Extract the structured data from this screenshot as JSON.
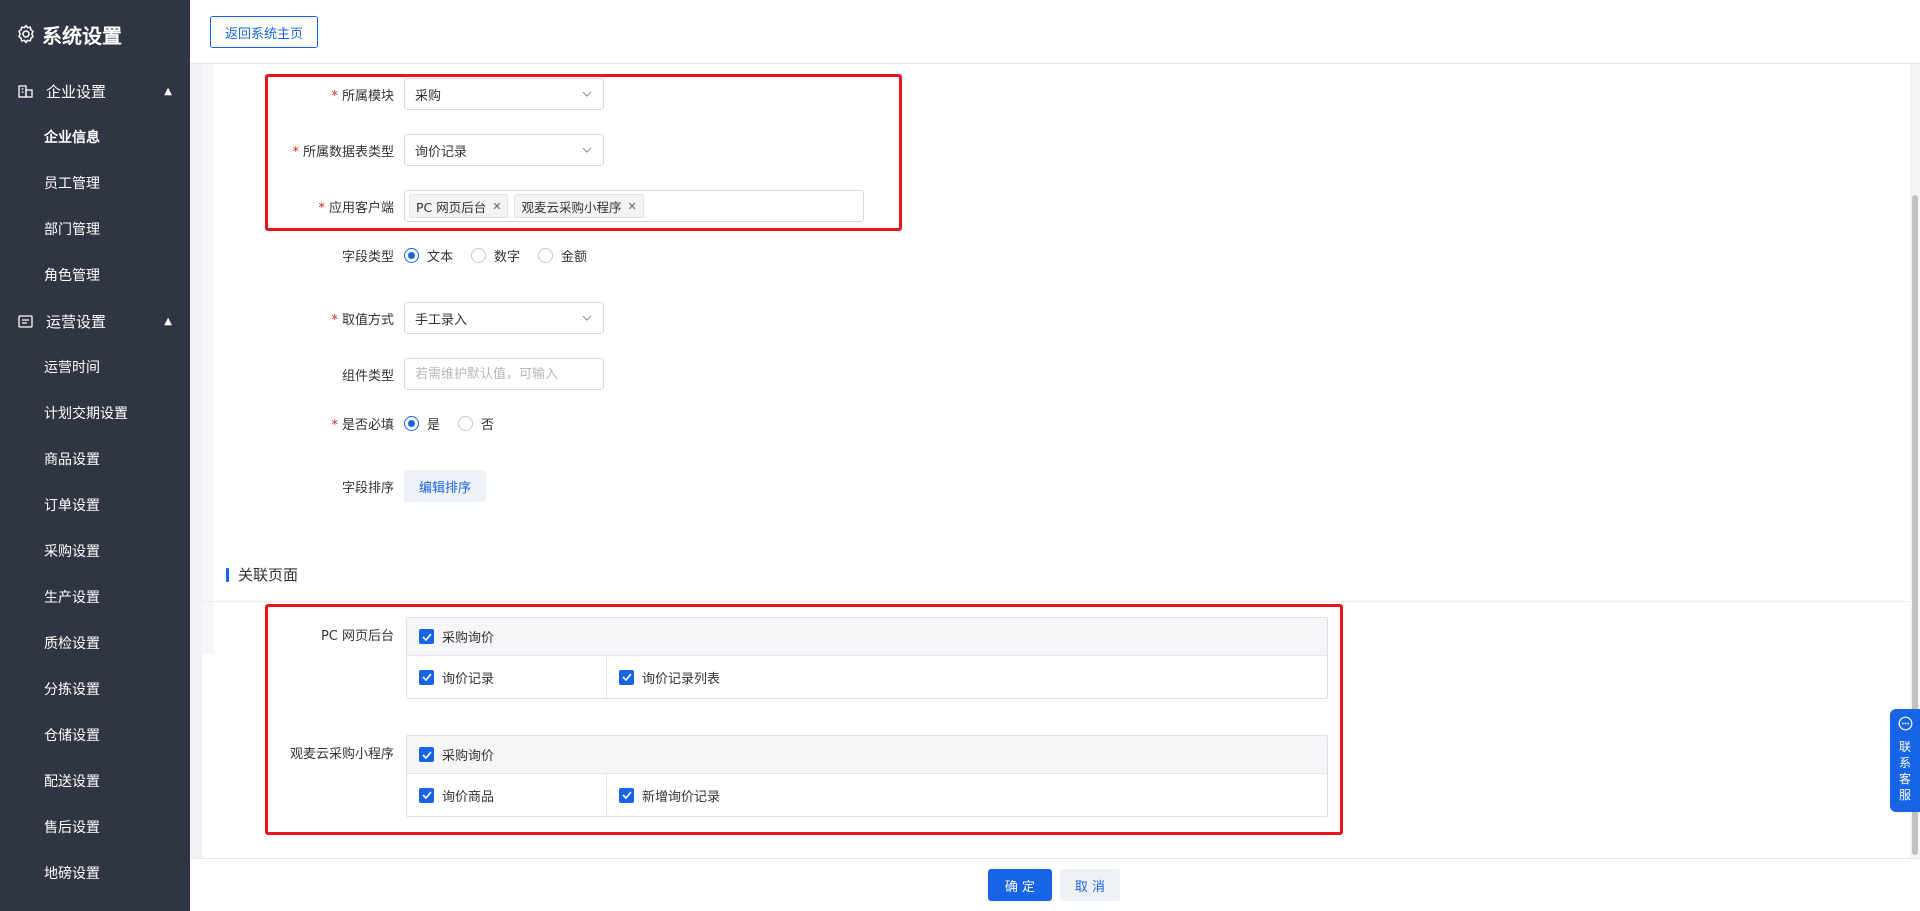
{
  "sidebar": {
    "title": "系统设置",
    "groups": [
      {
        "label": "企业设置",
        "items": [
          "企业信息",
          "员工管理",
          "部门管理",
          "角色管理"
        ]
      },
      {
        "label": "运营设置",
        "items": [
          "运营时间",
          "计划交期设置",
          "商品设置",
          "订单设置",
          "采购设置",
          "生产设置",
          "质检设置",
          "分拣设置",
          "仓储设置",
          "配送设置",
          "售后设置",
          "地磅设置"
        ]
      }
    ]
  },
  "topbar": {
    "back_label": "返回系统主页"
  },
  "form": {
    "module": {
      "label": "所属模块",
      "value": "采购"
    },
    "table_type": {
      "label": "所属数据表类型",
      "value": "询价记录"
    },
    "client": {
      "label": "应用客户端",
      "tags": [
        "PC 网页后台",
        "观麦云采购小程序"
      ]
    },
    "field_type": {
      "label": "字段类型",
      "options": [
        "文本",
        "数字",
        "金额"
      ],
      "selected": "文本"
    },
    "value_mode": {
      "label": "取值方式",
      "value": "手工录入"
    },
    "component_type": {
      "label": "组件类型",
      "placeholder": "若需维护默认值，可输入"
    },
    "required": {
      "label": "是否必填",
      "options": [
        "是",
        "否"
      ],
      "selected": "是"
    },
    "sort": {
      "label": "字段排序",
      "button": "编辑排序"
    }
  },
  "related": {
    "title": "关联页面",
    "groups": [
      {
        "label": "PC 网页后台",
        "parent": "采购询价",
        "children": [
          "询价记录",
          "询价记录列表"
        ]
      },
      {
        "label": "观麦云采购小程序",
        "parent": "采购询价",
        "children": [
          "询价商品",
          "新增询价记录"
        ]
      }
    ]
  },
  "footer": {
    "ok": "确 定",
    "cancel": "取 消"
  },
  "float_service": {
    "label": "联系客服"
  },
  "colors": {
    "primary": "#1765e6",
    "sidebar_bg": "#2f3542",
    "highlight": "#e8141a",
    "required": "#e02020"
  }
}
